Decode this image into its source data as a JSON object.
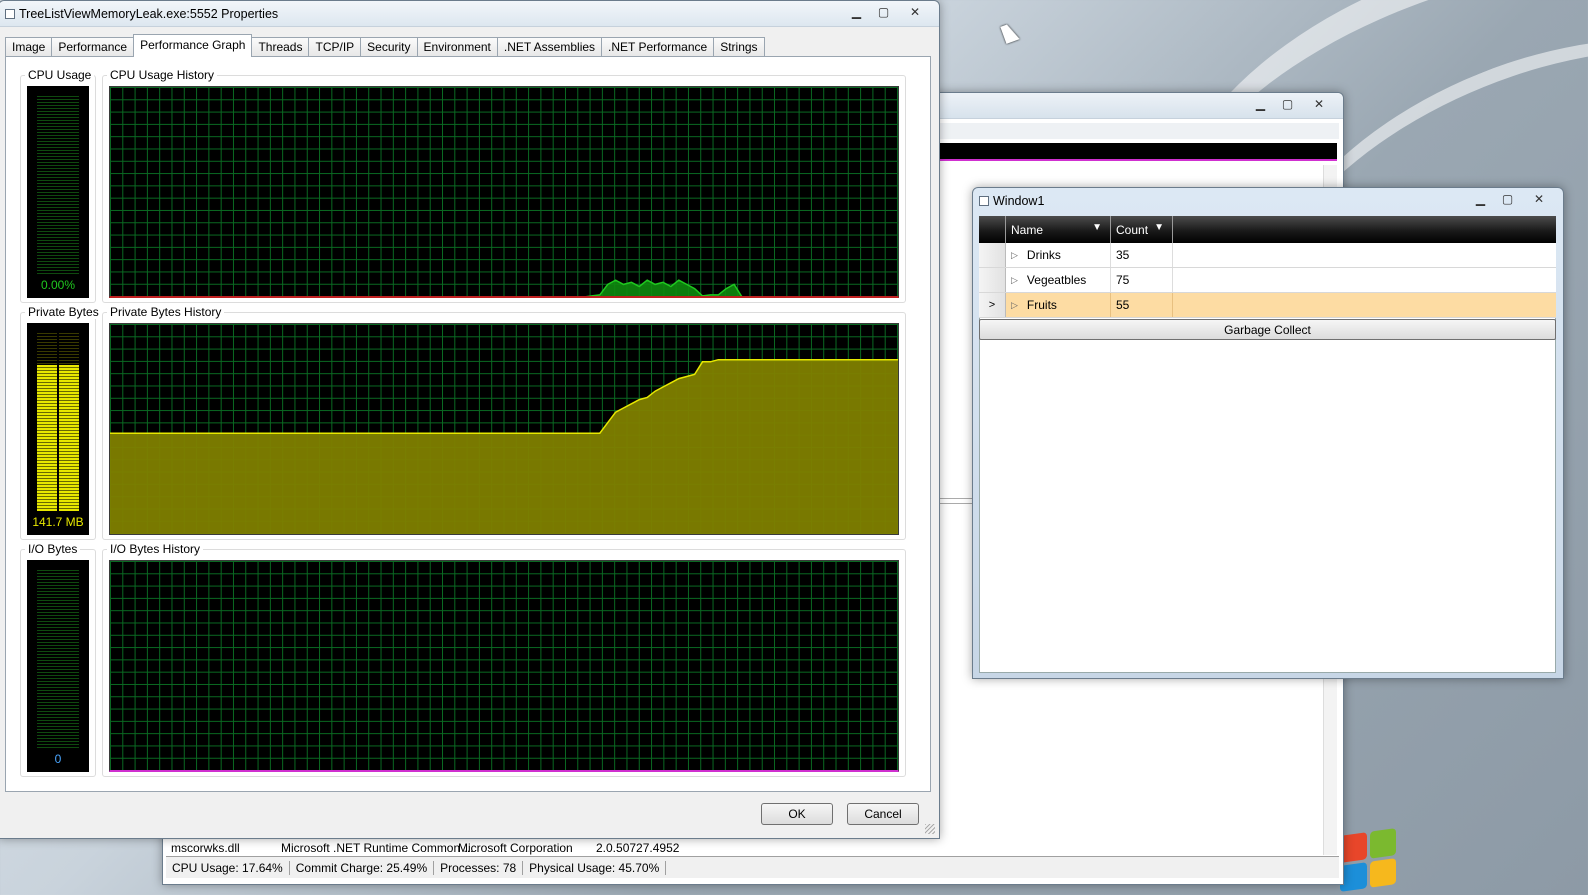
{
  "props": {
    "title": "TreeListViewMemoryLeak.exe:5552 Properties",
    "tabs": [
      "Image",
      "Performance",
      "Performance Graph",
      "Threads",
      "TCP/IP",
      "Security",
      "Environment",
      ".NET Assemblies",
      ".NET Performance",
      "Strings"
    ],
    "active_tab": "Performance Graph",
    "cpu": {
      "label": "CPU Usage",
      "history_label": "CPU Usage History",
      "value": "0.00%",
      "level": 0.0
    },
    "private": {
      "label": "Private Bytes",
      "history_label": "Private Bytes History",
      "value": "141.7 MB",
      "level": 0.82
    },
    "io": {
      "label": "I/O Bytes",
      "history_label": "I/O Bytes History",
      "value": "0",
      "level": 0.0
    },
    "ok_label": "OK",
    "cancel_label": "Cancel"
  },
  "procexp": {
    "row": {
      "name": "mscorwks.dll",
      "desc": "Microsoft .NET Runtime Common ...",
      "company": "Microsoft Corporation",
      "version": "2.0.50727.4952"
    },
    "status": {
      "cpu": "CPU Usage: 17.64%",
      "commit": "Commit Charge: 25.49%",
      "processes": "Processes: 78",
      "physical": "Physical Usage: 45.70%"
    }
  },
  "window1": {
    "title": "Window1",
    "columns": [
      "Name",
      "Count"
    ],
    "rows": [
      {
        "name": "Drinks",
        "count": "35"
      },
      {
        "name": "Vegeatbles",
        "count": "75"
      },
      {
        "name": "Fruits",
        "count": "55"
      }
    ],
    "selected_row": 2,
    "gc_button": "Garbage Collect"
  },
  "colors": {
    "grid": "#0a6a22",
    "cpu_series": "#1fc81f",
    "memory_fill": "#808000",
    "memory_line": "#e8e800",
    "selected_row": "#fddca3"
  },
  "chart_data": [
    {
      "type": "area",
      "title": "CPU Usage History",
      "x": [
        0,
        10,
        20,
        30,
        40,
        50,
        60,
        61,
        62,
        63,
        64,
        65,
        66,
        67,
        68,
        69,
        70,
        71,
        72,
        73,
        74,
        75,
        76,
        77,
        78,
        79,
        80,
        85,
        90,
        100
      ],
      "y": [
        0,
        0,
        0,
        0,
        0,
        0,
        0,
        0.5,
        1,
        6,
        8,
        6,
        7,
        5,
        8,
        6,
        7,
        5,
        8,
        6,
        4,
        0.5,
        1,
        1,
        4,
        6,
        0,
        0,
        0,
        0
      ],
      "ylim": [
        0,
        100
      ]
    },
    {
      "type": "area",
      "title": "Private Bytes History",
      "x": [
        0,
        10,
        20,
        30,
        40,
        50,
        60,
        61,
        62,
        63,
        64,
        65,
        66,
        67,
        68,
        69,
        70,
        71,
        72,
        73,
        74,
        75,
        76,
        77,
        78,
        79,
        80,
        85,
        90,
        100
      ],
      "y": [
        48,
        48,
        48,
        48,
        48,
        48,
        48,
        48,
        48,
        53,
        58,
        60,
        62,
        64,
        65,
        68,
        70,
        72,
        74,
        75,
        76,
        82,
        82,
        83,
        83,
        83,
        83,
        83,
        83,
        83
      ],
      "ylim": [
        0,
        100
      ]
    },
    {
      "type": "area",
      "title": "I/O Bytes History",
      "x": [
        0,
        100
      ],
      "y": [
        0,
        0
      ],
      "ylim": [
        0,
        100
      ]
    }
  ]
}
